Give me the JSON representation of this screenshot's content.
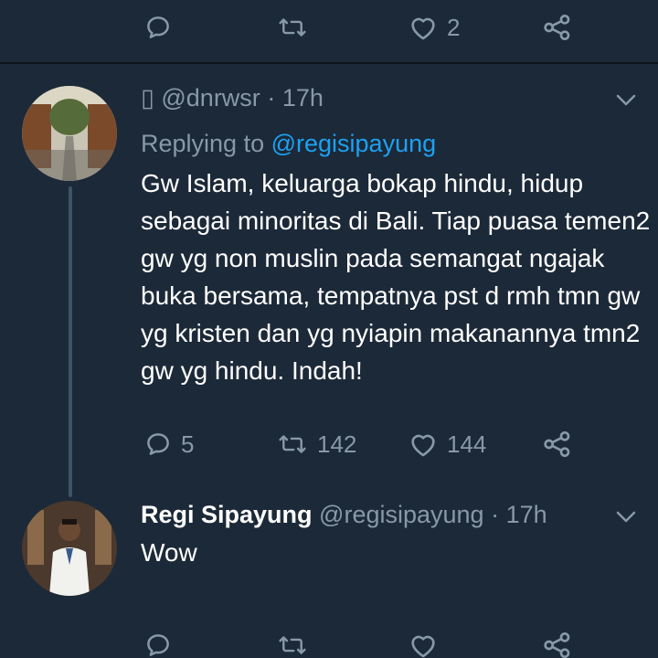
{
  "top_actions": {
    "likes": "2"
  },
  "tweet": {
    "name_glyph": "▯",
    "handle": "@dnrwsr",
    "separator": "·",
    "time": "17h",
    "replying_prefix": "Replying to",
    "replying_handle": "@regisipayung",
    "text": "Gw Islam, keluarga bokap hindu, hidup sebagai minoritas di Bali. Tiap puasa temen2 gw yg non muslin pada semangat ngajak buka bersama, tempatnya pst d rmh tmn gw yg kristen dan yg nyiapin makanannya tmn2 gw yg hindu. Indah!",
    "replies": "5",
    "retweets": "142",
    "likes": "144"
  },
  "reply": {
    "name": "Regi Sipayung",
    "handle": "@regisipayung",
    "separator": "·",
    "time": "17h",
    "text": "Wow"
  },
  "colors": {
    "background": "#1c2938",
    "muted": "#8899a6",
    "link": "#1da1f2",
    "thread_line": "#3d5466"
  },
  "icons": [
    "reply-icon",
    "retweet-icon",
    "like-icon",
    "share-icon",
    "chevron-down-icon"
  ]
}
